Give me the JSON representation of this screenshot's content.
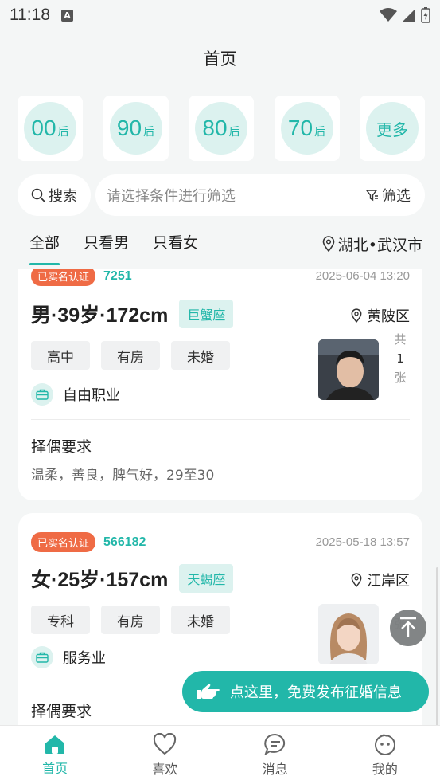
{
  "status_bar": {
    "time": "11:18",
    "notification_letter": "A"
  },
  "header": {
    "title": "首页"
  },
  "age_filters": [
    {
      "label": "00",
      "suffix": "后"
    },
    {
      "label": "90",
      "suffix": "后"
    },
    {
      "label": "80",
      "suffix": "后"
    },
    {
      "label": "70",
      "suffix": "后"
    },
    {
      "label": "更多",
      "suffix": ""
    }
  ],
  "search": {
    "button_label": "搜索",
    "placeholder": "请选择条件进行筛选",
    "filter_label": "筛选"
  },
  "tabs": [
    {
      "label": "全部",
      "active": true
    },
    {
      "label": "只看男",
      "active": false
    },
    {
      "label": "只看女",
      "active": false
    }
  ],
  "location": "湖北•武汉市",
  "cards": [
    {
      "badge": "已实名认证",
      "id": "7251",
      "date": "2025-06-04 13:20",
      "headline": "男·39岁·172cm",
      "zodiac": "巨蟹座",
      "district": "黄陂区",
      "tags": [
        "高中",
        "有房",
        "未婚"
      ],
      "job": "自由职业",
      "photo_count_prefix": "共",
      "photo_count": "1",
      "photo_count_suffix": "张",
      "requirement_title": "择偶要求",
      "requirement_text": "温柔，善良，脾气好，29至30"
    },
    {
      "badge": "已实名认证",
      "id": "566182",
      "date": "2025-05-18 13:57",
      "headline": "女·25岁·157cm",
      "zodiac": "天蝎座",
      "district": "江岸区",
      "tags": [
        "专科",
        "有房",
        "未婚"
      ],
      "job": "服务业",
      "photo_count_suffix": "张",
      "requirement_title": "择偶要求"
    }
  ],
  "post_button_label": "点这里，免费发布征婚信息",
  "bottom_nav": [
    {
      "label": "首页",
      "icon": "home-icon",
      "active": true
    },
    {
      "label": "喜欢",
      "icon": "heart-icon",
      "active": false
    },
    {
      "label": "消息",
      "icon": "message-icon",
      "active": false
    },
    {
      "label": "我的",
      "icon": "profile-icon",
      "active": false
    }
  ],
  "colors": {
    "accent": "#22b7a9",
    "badge": "#ef6b45",
    "accent_light": "#dcf2ef"
  }
}
